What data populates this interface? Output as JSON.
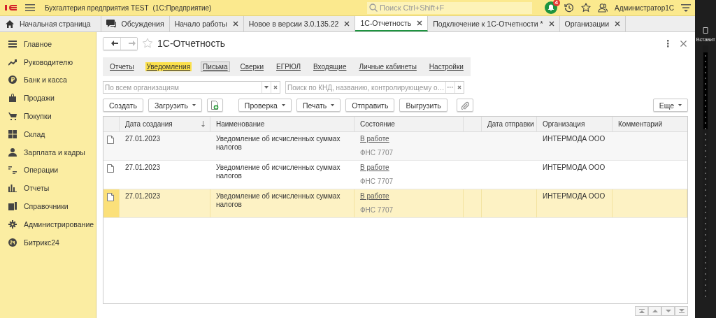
{
  "app": {
    "title": "Бухгалтерия предприятия TEST",
    "subtitle": "(1С:Предприятие)",
    "search": {
      "placeholder": "Поиск Ctrl+Shift+F"
    },
    "notifications": "4",
    "user": "Администратор1С"
  },
  "tabs": [
    {
      "label": "Начальная страница",
      "kind": "home",
      "closable": false,
      "selected": false
    },
    {
      "label": "Обсуждения",
      "kind": "chat",
      "closable": false,
      "selected": false
    },
    {
      "label": "Начало работы",
      "kind": "page",
      "closable": true,
      "selected": false
    },
    {
      "label": "Новое в версии 3.0.135.22",
      "kind": "page",
      "closable": true,
      "selected": false
    },
    {
      "label": "1С-Отчетность",
      "kind": "page",
      "closable": true,
      "selected": true
    },
    {
      "label": "Подключение к 1С-Отчетности *",
      "kind": "page",
      "closable": true,
      "selected": false
    },
    {
      "label": "Организации",
      "kind": "page",
      "closable": true,
      "selected": false
    }
  ],
  "sidebar": {
    "items": [
      {
        "label": "Главное"
      },
      {
        "label": "Руководителю"
      },
      {
        "label": "Банк и касса"
      },
      {
        "label": "Продажи"
      },
      {
        "label": "Покупки"
      },
      {
        "label": "Склад"
      },
      {
        "label": "Зарплата и кадры"
      },
      {
        "label": "Операции"
      },
      {
        "label": "Отчеты"
      },
      {
        "label": "Справочники"
      },
      {
        "label": "Администрирование"
      },
      {
        "label": "Битрикс24"
      }
    ]
  },
  "form": {
    "title": "1С-Отчетность",
    "nav": [
      {
        "label": "Отчеты",
        "selected": false,
        "focused": false
      },
      {
        "label": "Уведомления",
        "selected": true,
        "focused": false
      },
      {
        "label": "Письма",
        "selected": false,
        "focused": true
      },
      {
        "label": "Сверки",
        "selected": false,
        "focused": false
      },
      {
        "label": "ЕГРЮЛ",
        "selected": false,
        "focused": false
      },
      {
        "label": "Входящие",
        "selected": false,
        "focused": false
      },
      {
        "label": "Личные кабинеты",
        "selected": false,
        "focused": false
      },
      {
        "label": "Настройки",
        "selected": false,
        "focused": false
      }
    ],
    "org_filter": {
      "placeholder": "По всем организациям"
    },
    "search": {
      "placeholder": "Поиск по КНД, названию, контролирующему о…"
    },
    "toolbar": [
      {
        "kind": "button",
        "label": "Создать"
      },
      {
        "kind": "dropdown",
        "label": "Загрузить"
      },
      {
        "kind": "file-icon"
      },
      {
        "kind": "dropdown",
        "label": "Проверка"
      },
      {
        "kind": "dropdown",
        "label": "Печать"
      },
      {
        "kind": "button",
        "label": "Отправить"
      },
      {
        "kind": "button",
        "label": "Выгрузить"
      },
      {
        "kind": "clip-icon"
      }
    ],
    "more": "Еще",
    "table": {
      "columns": [
        {
          "label": "Дата создания",
          "sorted": true
        },
        {
          "label": "Наименование",
          "sorted": false
        },
        {
          "label": "Состояние",
          "sorted": false
        },
        {
          "label": "Дата отправки",
          "sorted": false
        },
        {
          "label": "Организация",
          "sorted": false
        },
        {
          "label": "Комментарий",
          "sorted": false
        }
      ],
      "rows": [
        {
          "date": "27.01.2023",
          "name": "Уведомление об исчисленных суммах налогов",
          "status": "В работе",
          "authority": "ФНС 7707",
          "org": "ИНТЕРМОДА ООО",
          "selected": false
        },
        {
          "date": "27.01.2023",
          "name": "Уведомление об исчисленных суммах налогов",
          "status": "В работе",
          "authority": "ФНС 7707",
          "org": "ИНТЕРМОДА ООО",
          "selected": false
        },
        {
          "date": "27.01.2023",
          "name": "Уведомление об исчисленных суммах налогов",
          "status": "В работе",
          "authority": "ФНС 7707",
          "org": "ИНТЕРМОДА ООО",
          "selected": true
        }
      ]
    }
  },
  "side_app": {
    "label": "Вставит"
  }
}
